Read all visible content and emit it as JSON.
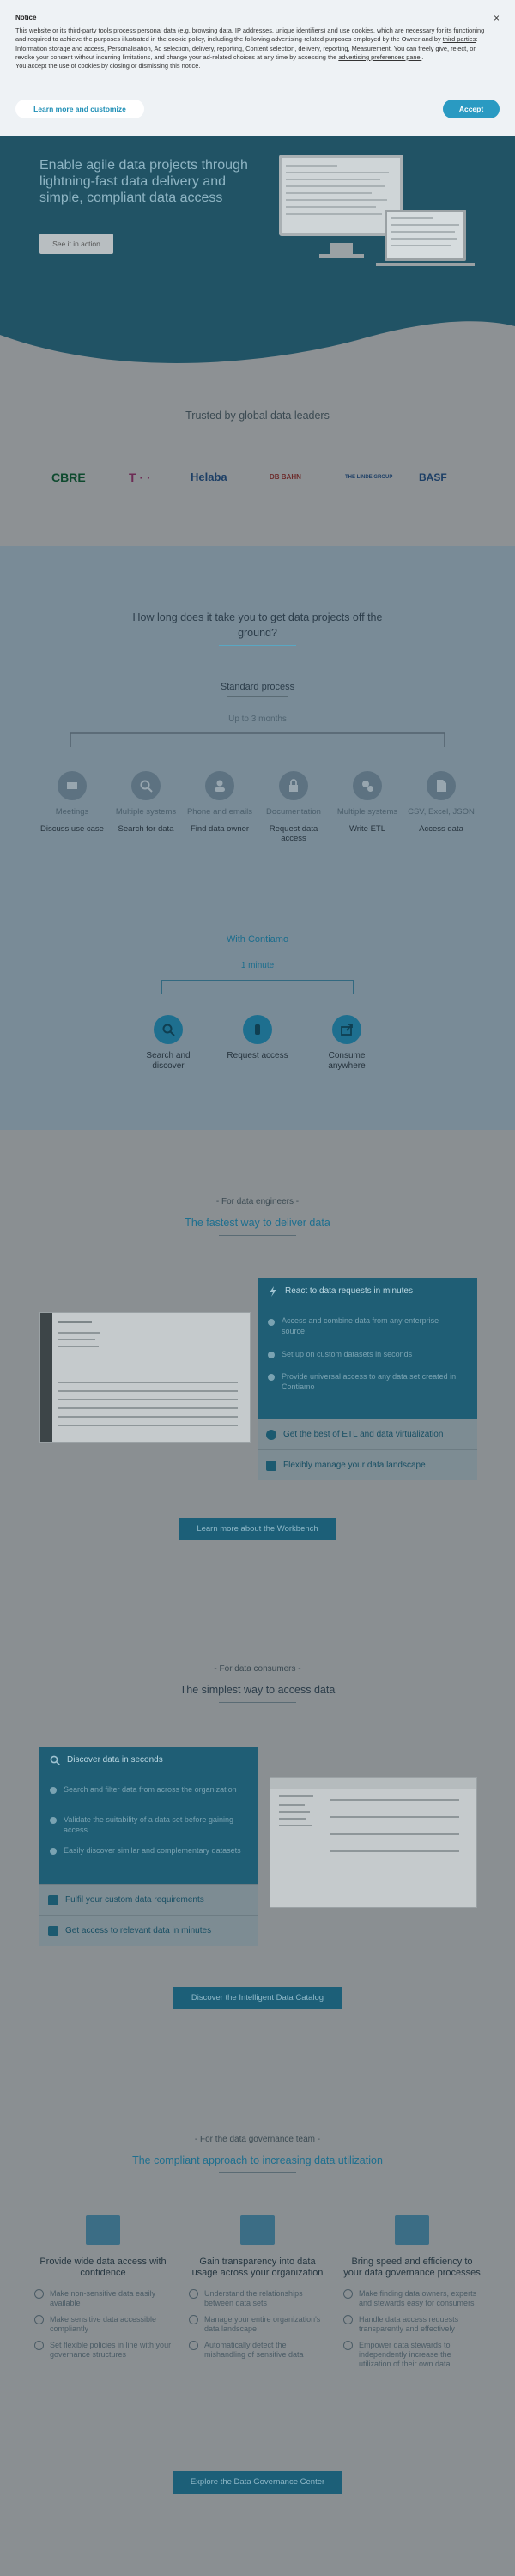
{
  "notice": {
    "title": "Notice",
    "close": "×",
    "text_1": "This website or its third-party tools process personal data (e.g. browsing data, IP addresses, unique identifiers) and use cookies, which are necessary for its functioning and required to achieve the purposes illustrated in the cookie policy, including the following advertising-related purposes employed by the Owner and by ",
    "third_parties": "third parties",
    "text_2": ": Information storage and access, Personalisation, Ad selection, delivery, reporting, Content selection, delivery, reporting, Measurement. You can freely give, reject, or revoke your consent without incurring limitations, and change your ad-related choices at any time by accessing the ",
    "adv_prefs": "advertising preferences panel",
    "text_3": ".",
    "text_4": "You accept the use of cookies by closing or dismissing this notice.",
    "learn_more": "Learn more and customize",
    "accept": "Accept"
  },
  "hero": {
    "title": "Enable agile data projects through lightning-fast data delivery and simple, compliant data access",
    "cta": "See it in action"
  },
  "trusted": {
    "title": "Trusted by global data leaders",
    "logos": [
      "CBRE",
      "T · ·",
      "Helaba",
      "DB BAHN",
      "THE LINDE GROUP",
      "BASF"
    ]
  },
  "howlong": {
    "title_line1": "How long does it take you to get data projects off the",
    "title_line2": "ground?",
    "standard": "Standard process",
    "duration": "Up to 3 months",
    "steps": [
      {
        "label": "Meetings",
        "sub": "Discuss use case"
      },
      {
        "label": "Multiple systems",
        "sub": "Search for data"
      },
      {
        "label": "Phone and emails",
        "sub": "Find data owner"
      },
      {
        "label": "Documentation",
        "sub": "Request data access"
      },
      {
        "label": "Multiple systems",
        "sub": "Write ETL"
      },
      {
        "label": "CSV, Excel, JSON",
        "sub": "Access data"
      }
    ],
    "with": "With Contiamo",
    "with_duration": "1 minute",
    "csteps": [
      "Search and discover",
      "Request access",
      "Consume anywhere"
    ]
  },
  "engineers": {
    "pre": "- For data engineers -",
    "title": "The fastest way to deliver data",
    "box_head": "React to data requests in minutes",
    "bullets": [
      "Access and combine data from any enterprise source",
      "Set up on custom datasets in seconds",
      "Provide universal access to any data set created in Contiamo"
    ],
    "row1": "Get the best of ETL and data virtualization",
    "row2": "Flexibly manage your data landscape",
    "cta": "Learn more about the Workbench"
  },
  "consumers": {
    "pre": "- For data consumers -",
    "title": "The simplest way to access data",
    "box_head": "Discover data in seconds",
    "bullets": [
      "Search and filter data from across the organization",
      "Validate the suitability of a data set before gaining access",
      "Easily discover similar and complementary datasets"
    ],
    "row1": "Fulfil your custom data requirements",
    "row2": "Get access to relevant data in minutes",
    "cta": "Discover the Intelligent Data Catalog"
  },
  "governance": {
    "pre": "- For the data governance team -",
    "title": "The compliant approach to increasing data utilization",
    "cols": [
      {
        "title": "Provide wide data access with confidence",
        "bullets": [
          "Make non-sensitive data easily available",
          "Make sensitive data accessible compliantly",
          "Set flexible policies in line with your governance structures"
        ]
      },
      {
        "title": "Gain transparency into data usage across your organization",
        "bullets": [
          "Understand the relationships between data sets",
          "Manage your entire organization's data landscape",
          "Automatically detect the mishandling of sensitive data"
        ]
      },
      {
        "title": "Bring speed and efficiency to your data governance processes",
        "bullets": [
          "Make finding data owners, experts and stewards easy for consumers",
          "Handle data access requests transparently and effectively",
          "Empower data stewards to independently increase the utilization of their own data"
        ]
      }
    ],
    "cta": "Explore the Data Governance Center"
  },
  "colors": {
    "accent": "#2a9ac2",
    "dark_teal": "#1f5e75"
  }
}
